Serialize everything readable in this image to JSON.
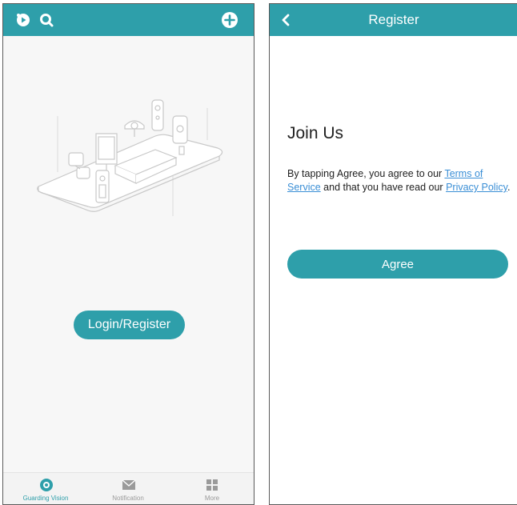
{
  "colors": {
    "accent": "#2e9faa",
    "link": "#3b8fd6",
    "nav_inactive": "#9a9a9a"
  },
  "home": {
    "topbar_icons": [
      "play-icon",
      "search-icon",
      "add-icon"
    ],
    "illustration": "smart-home-devices-illustration",
    "login_button": "Login/Register",
    "bottom_nav": [
      {
        "label": "Guarding Vision",
        "icon": "guarding-vision-icon",
        "active": true
      },
      {
        "label": "Notification",
        "icon": "envelope-icon",
        "active": false
      },
      {
        "label": "More",
        "icon": "grid-icon",
        "active": false
      }
    ]
  },
  "register": {
    "title": "Register",
    "back_icon": "back-arrow-icon",
    "heading": "Join Us",
    "agreement": {
      "prefix": "By tapping Agree, you agree to our ",
      "terms_link": "Terms of Service",
      "middle": " and that you have read our ",
      "privacy_link": "Privacy Policy",
      "suffix": "."
    },
    "agree_button": "Agree"
  }
}
